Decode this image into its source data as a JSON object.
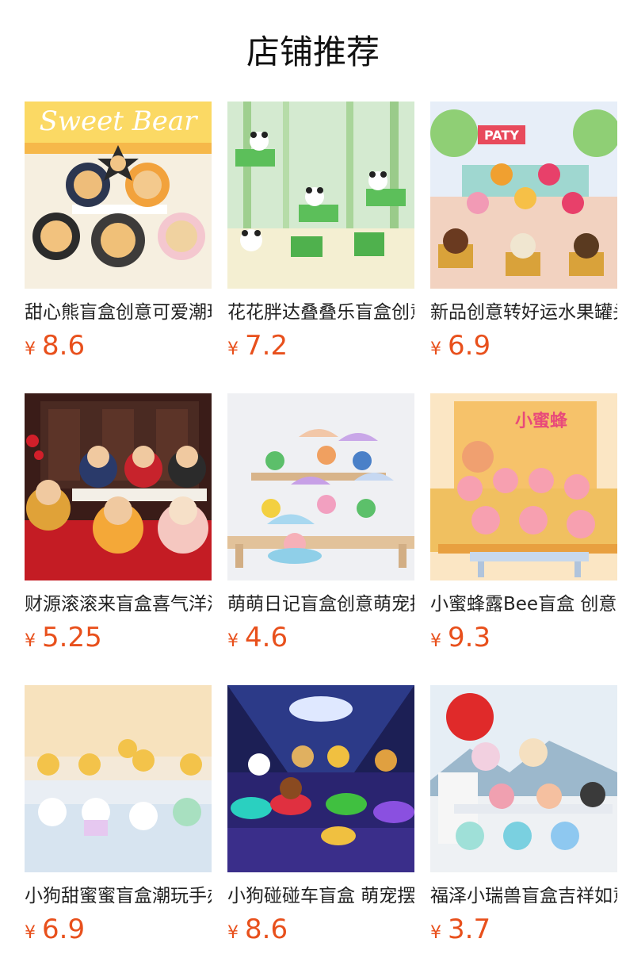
{
  "page": {
    "title": "店铺推荐",
    "currency": "¥"
  },
  "products": [
    {
      "name": "甜心熊盲盒创意可爱潮玩",
      "price": "8.6",
      "banner": "Sweet Bear",
      "image": "sweet-bear-figures-image",
      "colors": [
        "#fbe6b0",
        "#f6f0e4"
      ]
    },
    {
      "name": "花花胖达叠叠乐盲盒创意",
      "price": "7.2",
      "image": "panda-bamboo-figures-image",
      "colors": [
        "#cfe8c8",
        "#f3f0dc"
      ]
    },
    {
      "name": "新品创意转好运水果罐头",
      "price": "6.9",
      "banner": "PATY",
      "image": "fruit-can-figures-image",
      "colors": [
        "#e7eef8",
        "#f1dbc8"
      ]
    },
    {
      "name": "财源滚滚来盲盒喜气洋洋",
      "price": "5.25",
      "image": "fortune-god-figures-image",
      "colors": [
        "#5b2a22",
        "#b81f2a"
      ]
    },
    {
      "name": "萌萌日记盲盒创意萌宠摆件",
      "price": "4.6",
      "image": "umbrella-pets-figures-image",
      "colors": [
        "#f0f1f4",
        "#e4e6ea"
      ]
    },
    {
      "name": "小蜜蜂露Bee盲盒 创意",
      "price": "9.3",
      "banner": "小蜜蜂",
      "image": "bee-loopy-figures-image",
      "colors": [
        "#fbe5c0",
        "#f2d7a8"
      ]
    },
    {
      "name": "小狗甜蜜蜜盲盒潮玩手办",
      "price": "6.9",
      "image": "sweet-dog-figures-image",
      "colors": [
        "#f7e6cc",
        "#dfeaf4"
      ]
    },
    {
      "name": "小狗碰碰车盲盒 萌宠摆件",
      "price": "8.6",
      "image": "bumper-car-dog-figures-image",
      "colors": [
        "#1d1f5a",
        "#6a4fb0"
      ]
    },
    {
      "name": "福泽小瑞兽盲盒吉祥如意",
      "price": "3.7",
      "image": "lucky-beast-figures-image",
      "colors": [
        "#dfeaf3",
        "#f3f4f6"
      ]
    }
  ]
}
